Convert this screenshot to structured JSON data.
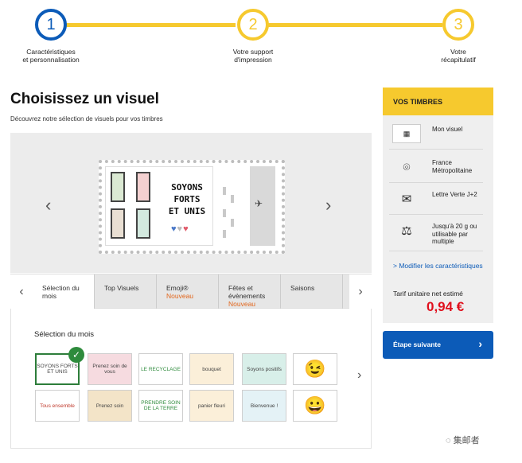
{
  "stepper": {
    "steps": [
      {
        "number": "1",
        "label_1": "Caractéristiques",
        "label_2": "et personnalisation"
      },
      {
        "number": "2",
        "label_1": "Votre support",
        "label_2": "d'impression"
      },
      {
        "number": "3",
        "label_1": "Votre",
        "label_2": "récapitulatif"
      }
    ]
  },
  "main": {
    "title": "Choisissez un visuel",
    "subtitle": "Découvrez notre sélection de visuels pour vos timbres"
  },
  "stamp": {
    "line_1": "SOYONS",
    "line_2": "FORTS",
    "line_3": "ET UNIS"
  },
  "tabs": [
    {
      "label": "Sélection du mois",
      "badge": ""
    },
    {
      "label": "Top Visuels",
      "badge": ""
    },
    {
      "label": "Emoji®",
      "badge": "Nouveau"
    },
    {
      "label": "Fêtes et évènements",
      "badge": "Nouveau"
    },
    {
      "label": "Saisons",
      "badge": ""
    }
  ],
  "gallery": {
    "title": "Sélection du mois",
    "thumbs": [
      "SOYONS FORTS ET UNIS",
      "Prenez soin de vous",
      "LE RECYCLAGE",
      "bouquet",
      "Soyons positifs",
      "emoji wink",
      "Tous ensemble",
      "Prenez soin",
      "PRENDRE SOIN DE LA TERRE",
      "panier fleuri",
      "Bienvenue !",
      "emoji smile"
    ]
  },
  "panel": {
    "header": "VOS TIMBRES",
    "rows": [
      {
        "icon": "stamp-thumbnail-icon",
        "text": "Mon visuel"
      },
      {
        "icon": "location-pin-icon",
        "text": "France Métropolitaine"
      },
      {
        "icon": "envelope-icon",
        "text": "Lettre Verte J+2"
      },
      {
        "icon": "weight-icon",
        "text": "Jusqu'à 20 g ou utilisable par multiple"
      }
    ],
    "modify_label": "> Modifier les caractéristiques",
    "tarif_label": "Tarif unitaire net estimé",
    "price": "0,94 €",
    "next_button": "Étape suivante"
  },
  "colors": {
    "accent_yellow": "#f6c92e",
    "primary_blue": "#0c5bb8",
    "price_red": "#e0101d",
    "badge_orange": "#e2661c"
  },
  "watermark": "集邮者"
}
